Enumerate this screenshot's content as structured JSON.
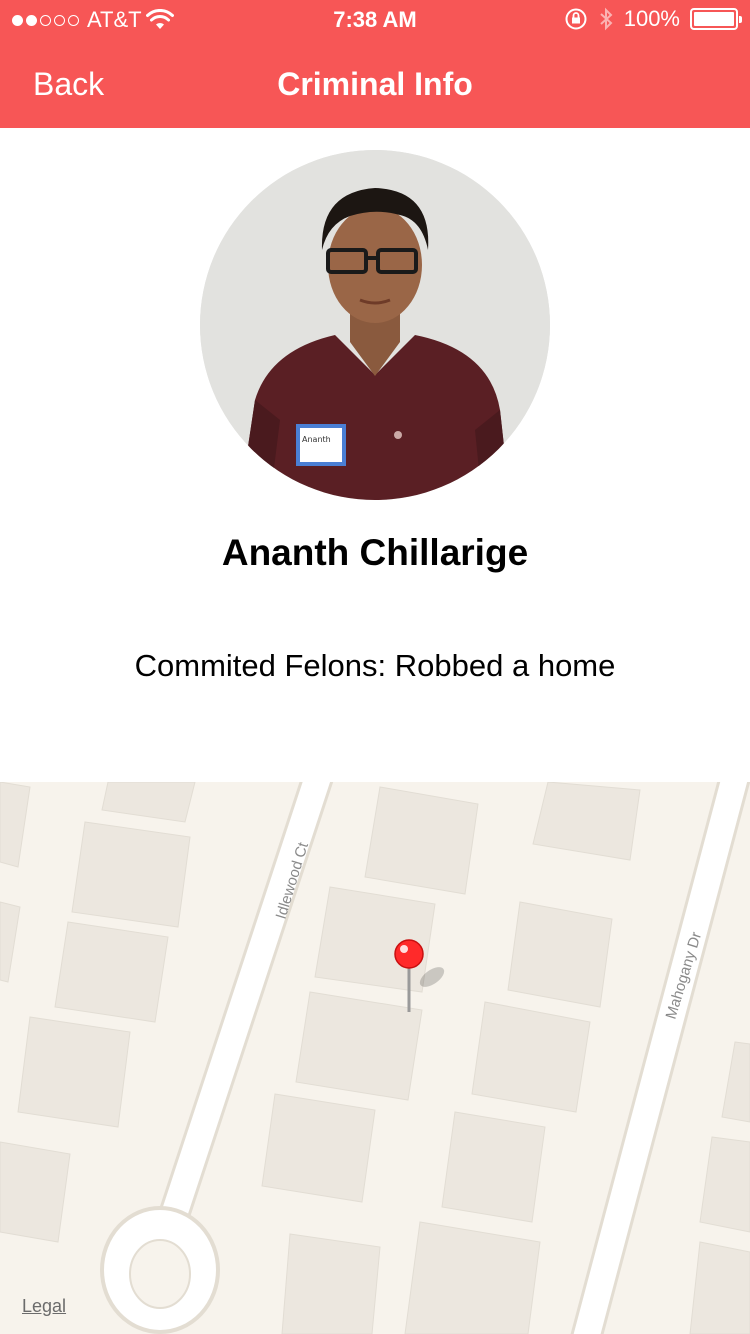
{
  "status_bar": {
    "carrier": "AT&T",
    "time": "7:38 AM",
    "battery": "100%",
    "signal_bars_filled": 2,
    "signal_bars_total": 5
  },
  "nav": {
    "back_label": "Back",
    "title": "Criminal Info"
  },
  "profile": {
    "name": "Ananth Chillarige",
    "name_tag": "Ananth",
    "crime_text": "Commited Felons: Robbed a home"
  },
  "map": {
    "street_left": "Idlewood Ct",
    "street_right": "Mahogany Dr",
    "legal_label": "Legal",
    "pin_color": "#ff2a2a"
  },
  "colors": {
    "accent": "#f75656"
  }
}
